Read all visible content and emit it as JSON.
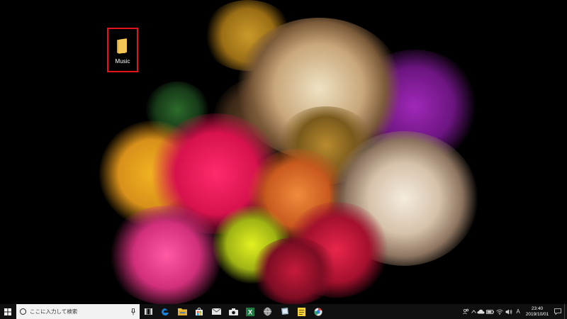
{
  "desktop": {
    "icons": [
      {
        "label": "Music",
        "icon": "folder-icon",
        "selected": true
      }
    ]
  },
  "taskbar": {
    "start_icon": "windows-logo-icon",
    "search": {
      "placeholder": "ここに入力して検索",
      "mic_icon": "microphone-icon"
    },
    "apps": [
      {
        "name": "task-view",
        "icon": "task-view-icon"
      },
      {
        "name": "edge",
        "icon": "edge-icon"
      },
      {
        "name": "file-explorer",
        "icon": "folder-icon"
      },
      {
        "name": "store",
        "icon": "store-icon"
      },
      {
        "name": "mail",
        "icon": "mail-icon"
      },
      {
        "name": "camera",
        "icon": "camera-icon"
      },
      {
        "name": "excel",
        "icon": "excel-icon"
      },
      {
        "name": "app-globe",
        "icon": "globe-icon"
      },
      {
        "name": "app-tablet",
        "icon": "tablet-icon"
      },
      {
        "name": "sticky-notes",
        "icon": "sticky-notes-icon"
      },
      {
        "name": "app-chrome",
        "icon": "chrome-icon"
      }
    ],
    "tray": {
      "ime_mode": "A",
      "time": "23:40",
      "date": "2019/10/01"
    }
  },
  "colors": {
    "taskbar_bg": "#101010",
    "selection_border": "#e3141b",
    "folder": "#f2c556",
    "edge": "#1a7fd6",
    "excel": "#1f7a43",
    "sticky": "#f5d23a"
  }
}
